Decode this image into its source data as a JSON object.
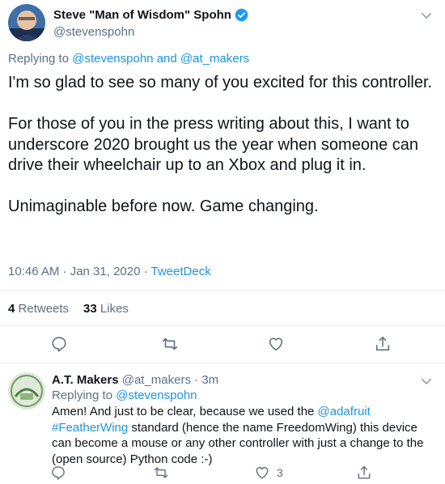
{
  "main_tweet": {
    "display_name": "Steve \"Man of Wisdom\" Spohn",
    "handle": "@stevenspohn",
    "replying_prefix": "Replying to",
    "replying_users": [
      "@stevenspohn",
      "@at_makers"
    ],
    "replying_and": "and",
    "text": "I'm so glad to see so many of you excited for this controller.\n\nFor those of you in the press writing about this, I want to underscore 2020 brought us the year when someone can drive their wheelchair up to an Xbox and plug it in.\n\nUnimaginable before now. Game changing.",
    "time": "10:46 AM · Jan 31, 2020",
    "sep": " · ",
    "source": "TweetDeck",
    "retweets_count": "4",
    "retweets_label": "Retweets",
    "likes_count": "33",
    "likes_label": "Likes"
  },
  "reply_tweet": {
    "display_name": "A.T. Makers",
    "handle": "@at_makers",
    "time": "· 3m",
    "replying_prefix": "Replying to",
    "replying_user": "@stevenspohn",
    "text_1": "Amen!  And just to be clear, because we used the ",
    "mention": "@adafruit",
    "hashtag": "#FeatherWing",
    "text_2": " standard (hence the name FreedomWing) this device can become a mouse or any other controller with just a change to the (open source) Python code :-)",
    "like_count": "3"
  },
  "icons": {
    "verified": "verified-badge-icon",
    "caret": "chevron-down-icon",
    "reply": "reply-icon",
    "retweet": "retweet-icon",
    "like": "heart-icon",
    "share": "share-icon"
  },
  "colors": {
    "link": "#1b95e0",
    "muted": "#5b7083",
    "text": "#0f1419",
    "divider": "#e6ecf0"
  }
}
